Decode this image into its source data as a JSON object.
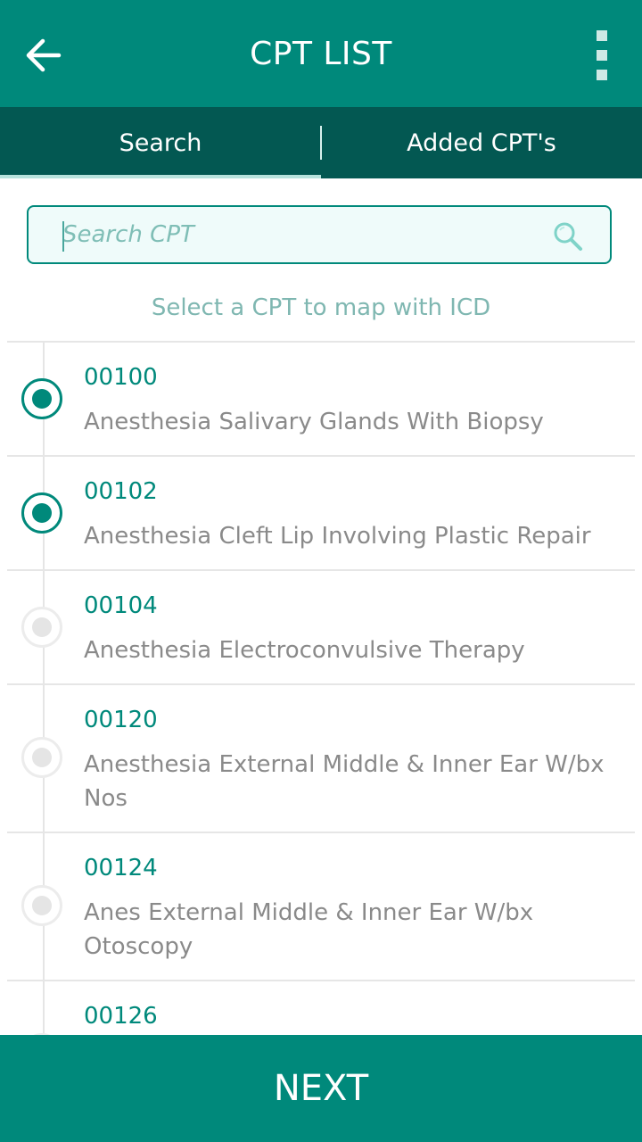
{
  "header": {
    "title": "CPT LIST"
  },
  "tabs": [
    {
      "label": "Search",
      "active": true
    },
    {
      "label": "Added CPT's",
      "active": false
    }
  ],
  "search": {
    "placeholder": "Search CPT",
    "value": ""
  },
  "hint": "Select a CPT to map with ICD",
  "items": [
    {
      "code": "00100",
      "description": "Anesthesia Salivary Glands With Biopsy",
      "selected": true
    },
    {
      "code": "00102",
      "description": "Anesthesia Cleft Lip Involving Plastic Repair",
      "selected": true
    },
    {
      "code": "00104",
      "description": "Anesthesia Electroconvulsive Therapy",
      "selected": false
    },
    {
      "code": "00120",
      "description": "Anesthesia External Middle & Inner Ear W/bx Nos",
      "selected": false
    },
    {
      "code": "00124",
      "description": "Anes External Middle & Inner Ear W/bx Otoscopy",
      "selected": false
    },
    {
      "code": "00126",
      "description": "",
      "selected": false
    }
  ],
  "footer": {
    "next_label": "NEXT"
  },
  "colors": {
    "primary": "#00897b",
    "tab_bar": "#035852",
    "secondary_text": "#8a8a8a"
  }
}
